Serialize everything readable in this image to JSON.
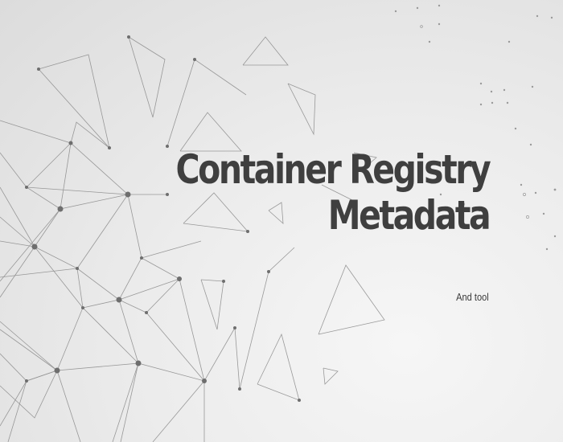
{
  "slide": {
    "title_line1": "Container Registry",
    "title_line2": "Metadata",
    "subtitle": "And tool"
  },
  "colors": {
    "title": "#3f3f3f",
    "network_line": "#8a8a8a",
    "network_node": "#6e6e6e"
  }
}
